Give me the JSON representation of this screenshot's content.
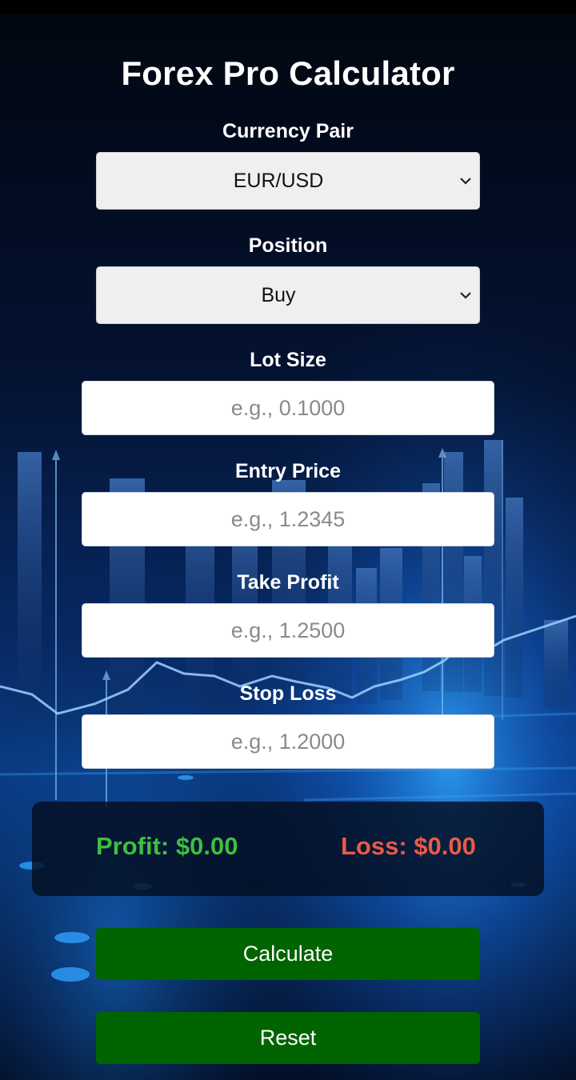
{
  "app": {
    "title": "Forex Pro Calculator"
  },
  "form": {
    "currency_pair": {
      "label": "Currency Pair",
      "selected": "EUR/USD",
      "icon": "chevron-down-icon"
    },
    "position": {
      "label": "Position",
      "selected": "Buy",
      "icon": "chevron-down-icon"
    },
    "lot_size": {
      "label": "Lot Size",
      "value": "",
      "placeholder": "e.g., 0.1000"
    },
    "entry_price": {
      "label": "Entry Price",
      "value": "",
      "placeholder": "e.g., 1.2345"
    },
    "take_profit": {
      "label": "Take Profit",
      "value": "",
      "placeholder": "e.g., 1.2500"
    },
    "stop_loss": {
      "label": "Stop Loss",
      "value": "",
      "placeholder": "e.g., 1.2000"
    }
  },
  "results": {
    "profit": "Profit: $0.00",
    "loss": "Loss: $0.00"
  },
  "buttons": {
    "calculate": "Calculate",
    "reset": "Reset"
  },
  "colors": {
    "accent_button": "#006400",
    "profit": "#3fbf3f",
    "loss": "#ea5a46",
    "background": "#020814"
  }
}
